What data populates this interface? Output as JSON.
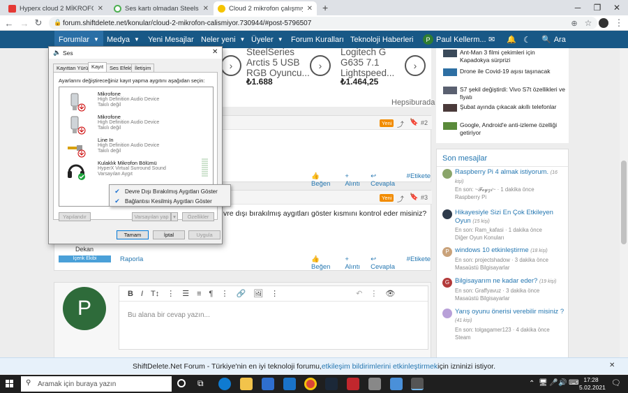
{
  "browser": {
    "tabs": [
      {
        "title": "Hyperx cloud 2 MİKROFONU ÇAL",
        "favicon_color": "#e53935",
        "active": false
      },
      {
        "title": "Ses kartı olmadan Steelseries Ar",
        "favicon_color": "#4caf50",
        "active": false
      },
      {
        "title": "Cloud 2 mikrofon çalışmıyor | Sh",
        "favicon_color": "#333333",
        "active": true
      }
    ],
    "new_tab": "+",
    "url": "forum.shiftdelete.net/konular/cloud-2-mikrofon-calismiyor.730944/#post-5796507",
    "window_controls": [
      "─",
      "❐",
      "✕"
    ]
  },
  "site_nav": {
    "items": [
      {
        "label": "Forumlar",
        "caret": true,
        "selected": true
      },
      {
        "label": "Medya",
        "caret": true
      },
      {
        "label": "Yeni Mesajlar",
        "caret": false
      },
      {
        "label": "Neler yeni",
        "caret": true
      },
      {
        "label": "Üyeler",
        "caret": true
      },
      {
        "label": "Forum Kuralları",
        "caret": false
      },
      {
        "label": "Teknoloji Haberleri",
        "caret": false
      }
    ],
    "user": "Paul Kellerm...",
    "user_initial": "P",
    "search": "Ara"
  },
  "ads": {
    "products": [
      {
        "name_lines": [
          "SteelSeries",
          "Arctis 5 USB",
          "RGB Oyuncu..."
        ],
        "price": "₺1.688"
      },
      {
        "name_lines": [
          "Logitech G",
          "G635 7.1",
          "Lightspeed..."
        ],
        "price": "₺1.464,25"
      }
    ],
    "source": "Hepsiburada"
  },
  "posts": [
    {
      "badge": "Yeni",
      "number": "#2",
      "actions": [
        "Beğen",
        "+ Alıntı",
        "Cevapla",
        "#Etikete"
      ]
    },
    {
      "badge": "Yeni",
      "number": "#3",
      "text": "vre dışı bırakılmış aygıtları göster kısmını kontrol eder misiniz?",
      "user_role": "Dekan",
      "user_title": "İçerik Ekibi",
      "report": "Raporla",
      "actions": [
        "Beğen",
        "+ Alıntı",
        "Cevapla",
        "#Etikete"
      ]
    }
  ],
  "reply": {
    "avatar_initial": "P",
    "placeholder": "Bu alana bir cevap yazın..."
  },
  "news": [
    {
      "title": "Ant-Man 3 filmi çekimleri için Kapadokya sürprizi",
      "thumb": "#3a4a5a"
    },
    {
      "title": "Drone ile Covid-19 aşısı taşınacak",
      "thumb": "#2d6fa3"
    },
    {
      "title": "S7 şekil değiştirdi: Vivo S7t özellikleri ve fiyatı",
      "thumb": "#5a6070"
    },
    {
      "title": "Şubat ayında çıkacak akıllı telefonlar",
      "thumb": "#4a3a3a"
    },
    {
      "title": "Google, Android'e anti-izleme özelliği getiriyor",
      "thumb": "#5a8a3a"
    }
  ],
  "latest": {
    "heading": "Son mesajlar",
    "items": [
      {
        "title": "Raspberry Pi 4 almak istiyorum.",
        "count": "(16 kişi)",
        "meta": "En son: ~𝓕𝓮𝔂𝔃𝓲~ · 1 dakika önce",
        "forum": "Raspberry Pi",
        "avatar": "#8aa56a",
        "initial": ""
      },
      {
        "title": "Hikayesiyle Sizi En Çok Etkileyen Oyun",
        "count": "(15 kişi)",
        "meta": "En son: Ram_kafasi · 1 dakika önce",
        "forum": "Diğer Oyun Konuları",
        "avatar": "#2e3a4a",
        "initial": ""
      },
      {
        "title": "windows 10 etkinleştirme",
        "count": "(18 kişi)",
        "meta": "En son: projectshadow · 3 dakika önce",
        "forum": "Masaüstü Bilgisayarlar",
        "avatar": "#c9a27a",
        "initial": "P"
      },
      {
        "title": "Bilgisayarım ne kadar eder?",
        "count": "(19 kişi)",
        "meta": "En son: Graffyavuz · 3 dakika önce",
        "forum": "Masaüstü Bilgisayarlar",
        "avatar": "#b33a3a",
        "initial": "G"
      },
      {
        "title": "Yarış oyunu önerisi verebilir misiniz ?",
        "count": "(41 kişi)",
        "meta": "En son: tolgagamer123 · 4 dakika önce",
        "forum": "Steam",
        "avatar": "#b8a0d8",
        "initial": ""
      }
    ]
  },
  "dialog": {
    "title": "Ses",
    "tabs": [
      "Kayıttan Yürüt",
      "Kayıt",
      "Ses Efekti",
      "İletişim"
    ],
    "selected_tab": "Kayıt",
    "instruction": "Ayarlarını değiştireceğiniz kayıt yapma aygıtını aşağıdan seçin:",
    "devices": [
      {
        "name": "Mikrofone",
        "driver": "High Definition Audio Device",
        "status": "Takılı değil",
        "icon": "microphone-icon"
      },
      {
        "name": "Mikrofone",
        "driver": "High Definition Audio Device",
        "status": "Takılı değil",
        "icon": "microphone-icon"
      },
      {
        "name": "Line In",
        "driver": "High Definition Audio Device",
        "status": "Takılı değil",
        "icon": "line-in-icon"
      },
      {
        "name": "Kulaklık Mikrofon Bölümü",
        "driver": "HyperX Virtual Surround Sound",
        "status": "Varsayılan Aygıt",
        "icon": "headset-icon"
      }
    ],
    "buttons": {
      "configure": "Yapılandır",
      "default": "Varsayılan yap",
      "properties": "Özellikler",
      "ok": "Tamam",
      "cancel": "İptal",
      "apply": "Uygula"
    },
    "context_menu": [
      "Devre Dışı Bırakılmış Aygıtları Göster",
      "Bağlantısı Kesilmiş Aygıtları Göster"
    ]
  },
  "notification": {
    "text_before": "ShiftDelete.Net Forum - Türkiye'nin en iyi teknoloji forumu, ",
    "link": "etkileşim bildirimlerini etkinleştirmek",
    "text_after": " için izninizi istiyor.",
    "close": "✕"
  },
  "taskbar": {
    "search_placeholder": "Aramak için buraya yazın",
    "time": "17:28",
    "date": "5.02.2021"
  }
}
